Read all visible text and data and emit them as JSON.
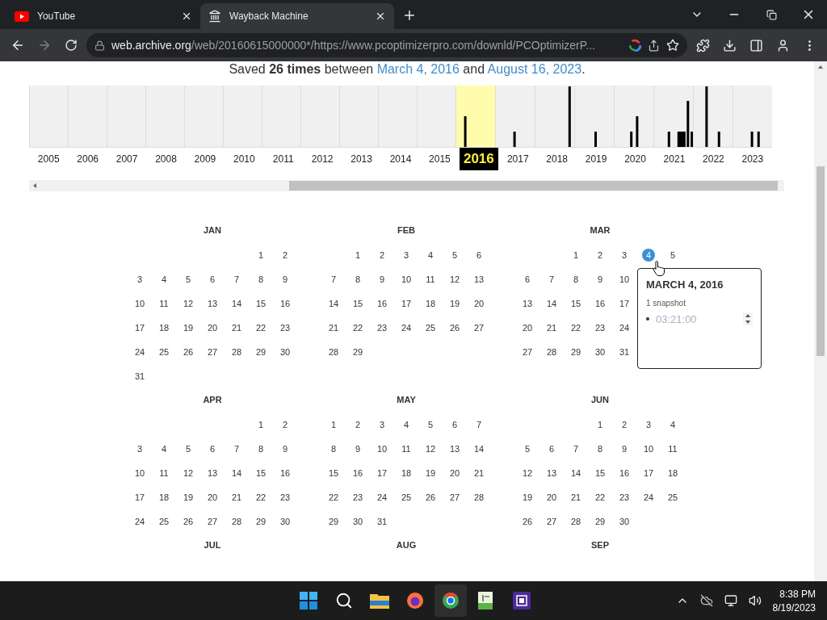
{
  "tabs": [
    {
      "title": "YouTube",
      "selected": false,
      "kind": "youtube"
    },
    {
      "title": "Wayback Machine",
      "selected": true,
      "kind": "archive"
    }
  ],
  "address": {
    "host": "web.archive.org",
    "path": "/web/20160615000000*/https://www.pcoptimizerpro.com/downld/PCOptimizerP..."
  },
  "summary": {
    "before": "Saved ",
    "count": "26 times",
    "middle": " between ",
    "first_link": "March 4, 2016",
    "and": " and ",
    "last_link": "August 16, 2023",
    "end": "."
  },
  "years": [
    {
      "label": "2005",
      "selected": false
    },
    {
      "label": "2006",
      "selected": false
    },
    {
      "label": "2007",
      "selected": false
    },
    {
      "label": "2008",
      "selected": false
    },
    {
      "label": "2009",
      "selected": false
    },
    {
      "label": "2010",
      "selected": false
    },
    {
      "label": "2011",
      "selected": false
    },
    {
      "label": "2012",
      "selected": false
    },
    {
      "label": "2013",
      "selected": false
    },
    {
      "label": "2014",
      "selected": false
    },
    {
      "label": "2015",
      "selected": false
    },
    {
      "label": "2016",
      "selected": true
    },
    {
      "label": "2017",
      "selected": false
    },
    {
      "label": "2018",
      "selected": false
    },
    {
      "label": "2019",
      "selected": false
    },
    {
      "label": "2020",
      "selected": false
    },
    {
      "label": "2021",
      "selected": false
    },
    {
      "label": "2022",
      "selected": false
    },
    {
      "label": "2023",
      "selected": false
    }
  ],
  "months": [
    {
      "name": "JAN",
      "weeks": [
        [
          "1",
          "2"
        ],
        [
          "3",
          "4",
          "5",
          "6",
          "7",
          "8",
          "9"
        ],
        [
          "10",
          "11",
          "12",
          "13",
          "14",
          "15",
          "16"
        ],
        [
          "17",
          "18",
          "19",
          "20",
          "21",
          "22",
          "23"
        ],
        [
          "24",
          "25",
          "26",
          "27",
          "28",
          "29",
          "30"
        ],
        [
          "31"
        ]
      ]
    },
    {
      "name": "FEB",
      "weeks": [
        [
          "1",
          "2",
          "3",
          "4",
          "5",
          "6"
        ],
        [
          "7",
          "8",
          "9",
          "10",
          "11",
          "12",
          "13"
        ],
        [
          "14",
          "15",
          "16",
          "17",
          "18",
          "19",
          "20"
        ],
        [
          "21",
          "22",
          "23",
          "24",
          "25",
          "26",
          "27"
        ],
        [
          "28",
          "29"
        ]
      ]
    },
    {
      "name": "MAR",
      "weeks": [
        [
          "1",
          "2",
          "3",
          {
            "day": "4",
            "snapshot": true
          },
          "5"
        ],
        [
          "6",
          "7",
          "8",
          "9",
          "10"
        ],
        [
          "13",
          "14",
          "15",
          "16",
          "17"
        ],
        [
          "20",
          "21",
          "22",
          "23",
          "24"
        ],
        [
          "27",
          "28",
          "29",
          "30",
          "31"
        ]
      ],
      "popup": {
        "title": "MARCH 4, 2016",
        "count": "1 snapshot",
        "times": [
          "03:21:00"
        ]
      }
    },
    {
      "name": "APR",
      "weeks": [
        [
          "1",
          "2"
        ],
        [
          "3",
          "4",
          "5",
          "6",
          "7",
          "8",
          "9"
        ],
        [
          "10",
          "11",
          "12",
          "13",
          "14",
          "15",
          "16"
        ],
        [
          "17",
          "18",
          "19",
          "20",
          "21",
          "22",
          "23"
        ],
        [
          "24",
          "25",
          "26",
          "27",
          "28",
          "29",
          "30"
        ]
      ]
    },
    {
      "name": "MAY",
      "weeks": [
        [
          "1",
          "2",
          "3",
          "4",
          "5",
          "6",
          "7"
        ],
        [
          "8",
          "9",
          "10",
          "11",
          "12",
          "13",
          "14"
        ],
        [
          "15",
          "16",
          "17",
          "18",
          "19",
          "20",
          "21"
        ],
        [
          "22",
          "23",
          "24",
          "25",
          "26",
          "27",
          "28"
        ],
        [
          "29",
          "30",
          "31"
        ]
      ]
    },
    {
      "name": "JUN",
      "weeks": [
        [
          "1",
          "2",
          "3",
          "4"
        ],
        [
          "5",
          "6",
          "7",
          "8",
          "9",
          "10",
          "11"
        ],
        [
          "12",
          "13",
          "14",
          "15",
          "16",
          "17",
          "18"
        ],
        [
          "19",
          "20",
          "21",
          "22",
          "23",
          "24",
          "25"
        ],
        [
          "26",
          "27",
          "28",
          "29",
          "30"
        ]
      ]
    },
    {
      "name": "JUL"
    },
    {
      "name": "AUG"
    },
    {
      "name": "SEP"
    }
  ],
  "clock": {
    "time": "8:38 PM",
    "date": "8/19/2023"
  }
}
